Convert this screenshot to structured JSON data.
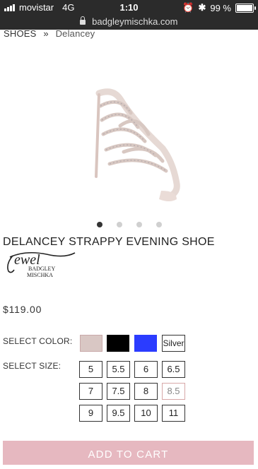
{
  "status": {
    "carrier": "movistar",
    "network": "4G",
    "time": "1:10",
    "battery": "99 %"
  },
  "browser": {
    "url": "badgleymischka.com"
  },
  "breadcrumb": {
    "parent": "SHOES",
    "separator": "»",
    "current": "Delancey"
  },
  "carousel": {
    "count": 4,
    "active": 0
  },
  "product": {
    "title": "DELANCEY STRAPPY EVENING SHOE",
    "brand_logo_text": [
      "Jewel",
      "BADGLEY",
      "MISCHKA"
    ],
    "price": "$119.00"
  },
  "color": {
    "label": "SELECT COLOR:",
    "options": [
      {
        "name": "blush",
        "hex": "#d9c7c4"
      },
      {
        "name": "black",
        "hex": "#000000"
      },
      {
        "name": "blue",
        "hex": "#2b3cff"
      },
      {
        "name": "silver",
        "label": "Silver"
      }
    ]
  },
  "size": {
    "label": "SELECT SIZE:",
    "options": [
      "5",
      "5.5",
      "6",
      "6.5",
      "7",
      "7.5",
      "8",
      "8.5",
      "9",
      "9.5",
      "10",
      "11"
    ],
    "unavailable": [
      "8.5"
    ]
  },
  "cart": {
    "label": "ADD TO CART"
  }
}
